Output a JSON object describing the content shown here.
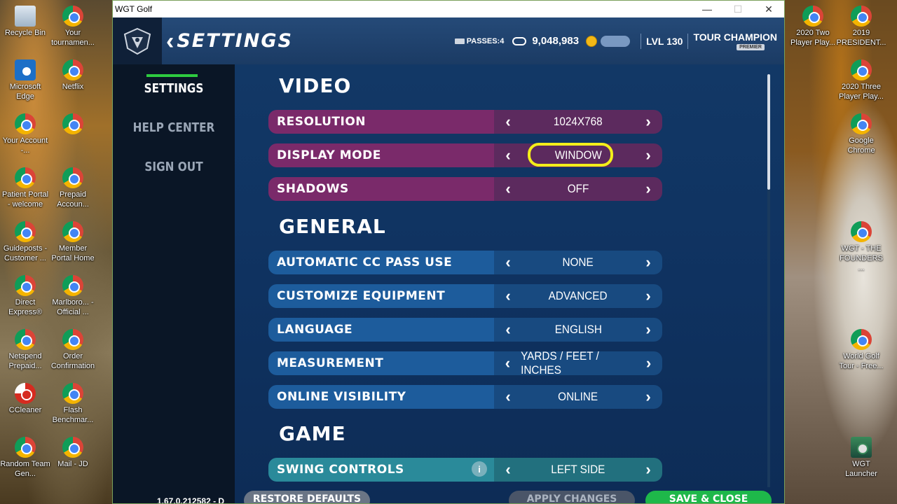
{
  "desktop_left": [
    {
      "label": "Recycle Bin",
      "icon": "recycle-bin-icon"
    },
    {
      "label": "Your tournamen...",
      "icon": "chrome-icon"
    },
    {
      "label": "Microsoft Edge",
      "icon": "edge-icon"
    },
    {
      "label": "Netflix",
      "icon": "chrome-icon"
    },
    {
      "label": "Your Account -...",
      "icon": "chrome-icon"
    },
    {
      "label": "",
      "icon": "chrome-icon"
    },
    {
      "label": "Patient Portal - welcome",
      "icon": "chrome-icon"
    },
    {
      "label": "Prepaid Accoun...",
      "icon": "chrome-icon"
    },
    {
      "label": "Guideposts - Customer ...",
      "icon": "chrome-icon"
    },
    {
      "label": "Member Portal Home",
      "icon": "chrome-icon"
    },
    {
      "label": "Direct Express®",
      "icon": "chrome-icon"
    },
    {
      "label": "Marlboro... - Official ...",
      "icon": "chrome-icon"
    },
    {
      "label": "Netspend Prepaid...",
      "icon": "chrome-icon"
    },
    {
      "label": "Order Confirmation",
      "icon": "chrome-icon"
    },
    {
      "label": "CCleaner",
      "icon": "ccleaner-icon"
    },
    {
      "label": "Flash Benchmar...",
      "icon": "chrome-icon"
    },
    {
      "label": "Random Team Gen...",
      "icon": "chrome-icon"
    },
    {
      "label": "Mail - JD",
      "icon": "chrome-icon"
    }
  ],
  "desktop_right": [
    {
      "label": "2020 Two Player Play...",
      "icon": "chrome-icon"
    },
    {
      "label": "2019 PRESIDENT...",
      "icon": "chrome-icon"
    },
    {
      "label": "2020 Three Player Play...",
      "icon": "chrome-icon"
    },
    {
      "label": "Google Chrome",
      "icon": "chrome-icon"
    },
    {
      "label": "WGT - THE FOUNDERS ...",
      "icon": "chrome-icon"
    },
    {
      "label": "World Golf Tour - Free...",
      "icon": "chrome-icon"
    },
    {
      "label": "WGT Launcher",
      "icon": "wgt-launcher-icon"
    }
  ],
  "window": {
    "title": "WGT Golf",
    "minimize": "—",
    "maximize": "☐",
    "close": "✕"
  },
  "header": {
    "back": "‹",
    "title": "SETTINGS",
    "passes": "PASSES:4",
    "credits": "9,048,983",
    "level": "LVL 130",
    "rank": "TOUR CHAMPION",
    "premier": "PREMIER"
  },
  "sidebar": {
    "items": [
      "SETTINGS",
      "HELP CENTER",
      "SIGN OUT"
    ]
  },
  "sections": {
    "video": "VIDEO",
    "general": "GENERAL",
    "game": "GAME"
  },
  "video_rows": [
    {
      "label": "RESOLUTION",
      "value": "1024X768"
    },
    {
      "label": "DISPLAY MODE",
      "value": "WINDOW"
    },
    {
      "label": "SHADOWS",
      "value": "OFF"
    }
  ],
  "general_rows": [
    {
      "label": "AUTOMATIC CC PASS USE",
      "value": "NONE"
    },
    {
      "label": "CUSTOMIZE EQUIPMENT",
      "value": "ADVANCED"
    },
    {
      "label": "LANGUAGE",
      "value": "ENGLISH"
    },
    {
      "label": "MEASUREMENT",
      "value": "YARDS / FEET / INCHES"
    },
    {
      "label": "ONLINE VISIBILITY",
      "value": "ONLINE"
    }
  ],
  "game_rows": [
    {
      "label": "SWING CONTROLS",
      "value": "LEFT SIDE",
      "info": "i"
    }
  ],
  "arrows": {
    "left": "‹",
    "right": "›"
  },
  "footer": {
    "version": "1.67.0.212582 - D",
    "restore": "RESTORE DEFAULTS",
    "apply": "APPLY CHANGES",
    "save": "SAVE & CLOSE"
  },
  "colors": {
    "video_row": "#7a2a6a",
    "general_row": "#1d5c9c",
    "game_row": "#2a8a9a",
    "save_button": "#1eb84a",
    "highlight": "#f4ee1a"
  }
}
